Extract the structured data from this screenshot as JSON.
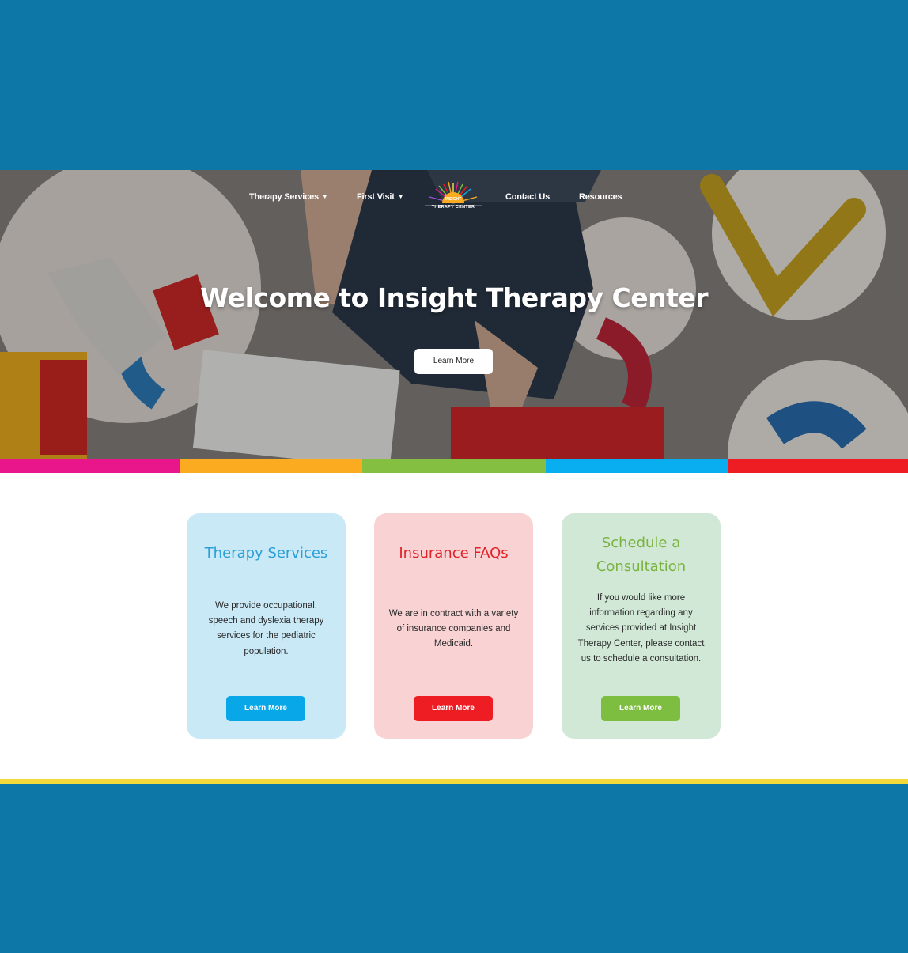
{
  "nav": {
    "items": [
      {
        "label": "Therapy Services",
        "dropdown": true
      },
      {
        "label": "First Visit",
        "dropdown": true
      },
      {
        "label": "Contact Us",
        "dropdown": false
      },
      {
        "label": "Resources",
        "dropdown": false
      }
    ],
    "logo": {
      "line1": "INSIGHT",
      "line2": "THERAPY CENTER"
    }
  },
  "hero": {
    "title": "Welcome to Insight Therapy Center",
    "button_label": "Learn More"
  },
  "stripe_colors": [
    "#e8168a",
    "#fbab1f",
    "#84bf41",
    "#08aeef",
    "#ee1d24"
  ],
  "cards": [
    {
      "title": "Therapy Services",
      "text": "We provide occupational, speech and dyslexia therapy services for the pediatric population.",
      "button_label": "Learn More",
      "bg": "#c9e9f7",
      "accent": "#2a9fd6",
      "button_color": "#08a7e8"
    },
    {
      "title": "Insurance FAQs",
      "text": "We are in contract with a variety of insurance companies and Medicaid.",
      "button_label": "Learn More",
      "bg": "#f9d2d3",
      "accent": "#e02228",
      "button_color": "#ee1d24"
    },
    {
      "title": "Schedule a Consultation",
      "text": "If you would like more information regarding any services provided at Insight Therapy Center, please contact us to schedule a consultation.",
      "button_label": "Learn More",
      "bg": "#d0e8d5",
      "accent": "#7bb340",
      "button_color": "#7dbd40"
    }
  ],
  "colors": {
    "brand_blue": "#0d77a8",
    "divider_yellow": "#f4d93a"
  }
}
